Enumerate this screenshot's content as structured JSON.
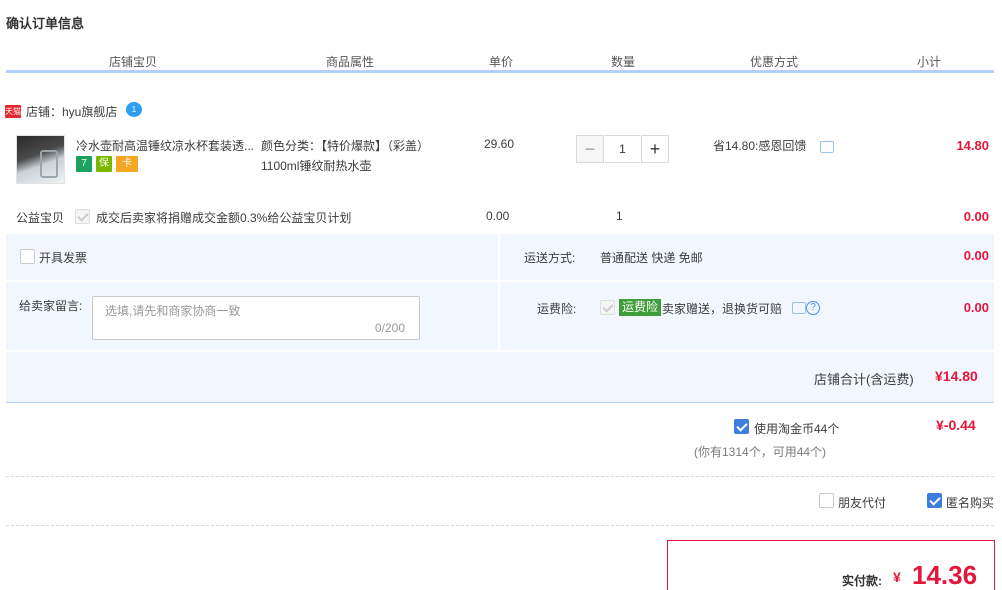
{
  "page": {
    "title": "确认订单信息"
  },
  "columns": [
    "店铺宝贝",
    "商品属性",
    "单价",
    "数量",
    "优惠方式",
    "小计"
  ],
  "shop": {
    "label": "店铺：hyu旗舰店",
    "badge": "天猫",
    "wangwang": "1"
  },
  "item": {
    "name": "冷水壶耐高温锤纹凉水杯套装透...",
    "service_icons": [
      "7",
      "保",
      "卡"
    ],
    "property_label": "颜色分类：【特价爆款】（彩盖）",
    "property_value": "1100ml锤纹耐热水壶",
    "unit_price": "29.60",
    "quantity": "1",
    "qty_minus": "−",
    "qty_plus": "+",
    "discount": "省14.80:感恩回馈",
    "subtotal": "14.80"
  },
  "charity": {
    "label": "公益宝贝",
    "text": "成交后卖家将捐赠成交金额0.3%给公益宝贝计划",
    "price": "0.00",
    "quantity": "1",
    "subtotal": "0.00"
  },
  "invoice": {
    "label": "开具发票"
  },
  "shipping": {
    "label": "运送方式:",
    "value": "普通配送 快递 免邮",
    "subtotal": "0.00"
  },
  "memo": {
    "label": "给卖家留言:",
    "placeholder": "选填,请先和商家协商一致",
    "count": "0/200"
  },
  "insurance": {
    "label": "运费险:",
    "tag": "运费险",
    "text": "卖家赠送，退换货可赔",
    "help": "?",
    "subtotal": "0.00"
  },
  "shop_total": {
    "label": "店铺合计(含运费)",
    "value": "¥14.80"
  },
  "coins": {
    "label": "使用淘金币44个",
    "sub": "(你有1314个，可用44个)",
    "value": "¥-0.44"
  },
  "options": {
    "friend_pay": "朋友代付",
    "anonymous": "匿名购买"
  },
  "payment": {
    "label": "实付款:",
    "currency": "¥",
    "value": "14.36"
  },
  "colors": {
    "accent_red": "#e4163a",
    "header_line": "#b2d1ff",
    "pane_bg": "#f2f7ff",
    "checkbox_blue": "#3d7ede",
    "insurance_green": "#3f9e3a"
  },
  "icons": {
    "shop_badge": "tmall-icon",
    "wangwang": "wangwang-chat-icon",
    "chat": "message-icon",
    "help": "help-circle-icon"
  }
}
